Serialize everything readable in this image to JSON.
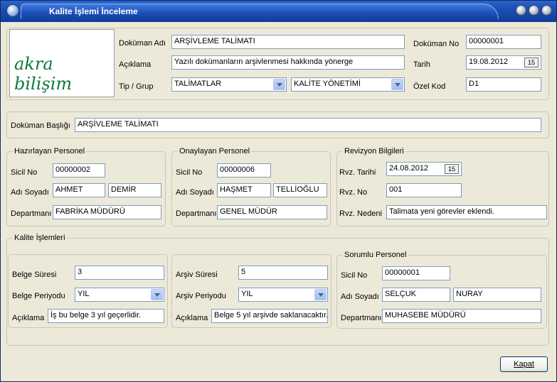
{
  "window": {
    "title": "Kalite İşlemi İnceleme"
  },
  "header": {
    "logo_text": "akra bilişim",
    "dokuman_adi_label": "Doküman Adı",
    "dokuman_adi": "ARŞİVLEME TALİMATI",
    "aciklama_label": "Açıklama",
    "aciklama": "Yazılı dokümanların arşivlenmesi hakkında yönerge",
    "tip_grup_label": "Tip / Grup",
    "tip": "TALİMATLAR",
    "grup": "KALİTE YÖNETİMİ",
    "dokuman_no_label": "Doküman No",
    "dokuman_no": "00000001",
    "tarih_label": "Tarih",
    "tarih": "19.08.2012",
    "ozel_kod_label": "Özel Kod",
    "ozel_kod": "D1",
    "calendar_icon_text": "15"
  },
  "baslik": {
    "label": "Doküman Başlığı",
    "value": "ARŞİVLEME TALİMATI"
  },
  "hazirlayan": {
    "group_label": "Hazırlayan Personel",
    "sicil_label": "Sicil No",
    "sicil": "00000002",
    "adsoyad_label": "Adı Soyadı",
    "ad": "AHMET",
    "soyad": "DEMİR",
    "departman_label": "Departmanı",
    "departman": "FABRİKA MÜDÜRÜ"
  },
  "onaylayan": {
    "group_label": "Onaylayan Personel",
    "sicil_label": "Sicil No",
    "sicil": "00000006",
    "adsoyad_label": "Adı Soyadı",
    "ad": "HAŞMET",
    "soyad": "TELLİOĞLU",
    "departman_label": "Departmanı",
    "departman": "GENEL MÜDÜR"
  },
  "revizyon": {
    "group_label": "Revizyon Bilgileri",
    "tarih_label": "Rvz. Tarihi",
    "tarih": "24.08.2012",
    "no_label": "Rvz. No",
    "no": "001",
    "neden_label": "Rvz. Nedeni",
    "neden": "Talimata yeni görevler eklendi.",
    "calendar_icon_text": "15"
  },
  "kalite": {
    "group_label": "Kalite İşlemleri",
    "belge_suresi_label": "Belge Süresi",
    "belge_suresi": "3",
    "belge_periyodu_label": "Belge Periyodu",
    "belge_periyodu": "YIL",
    "belge_aciklama_label": "Açıklama",
    "belge_aciklama": "İş bu belge 3 yıl geçerlidir.",
    "arsiv_suresi_label": "Arşiv Süresi",
    "arsiv_suresi": "5",
    "arsiv_periyodu_label": "Arşiv Periyodu",
    "arsiv_periyodu": "YIL",
    "arsiv_aciklama_label": "Açıklama",
    "arsiv_aciklama": "Belge 5 yıl arşivde saklanacaktır."
  },
  "sorumlu": {
    "group_label": "Sorumlu Personel",
    "sicil_label": "Sicil No",
    "sicil": "00000001",
    "adsoyad_label": "Adı Soyadı",
    "ad": "SELÇUK",
    "soyad": "NURAY",
    "departman_label": "Departmanı",
    "departman": "MUHASEBE MÜDÜRÜ"
  },
  "footer": {
    "kapat_label": "Kapat"
  }
}
